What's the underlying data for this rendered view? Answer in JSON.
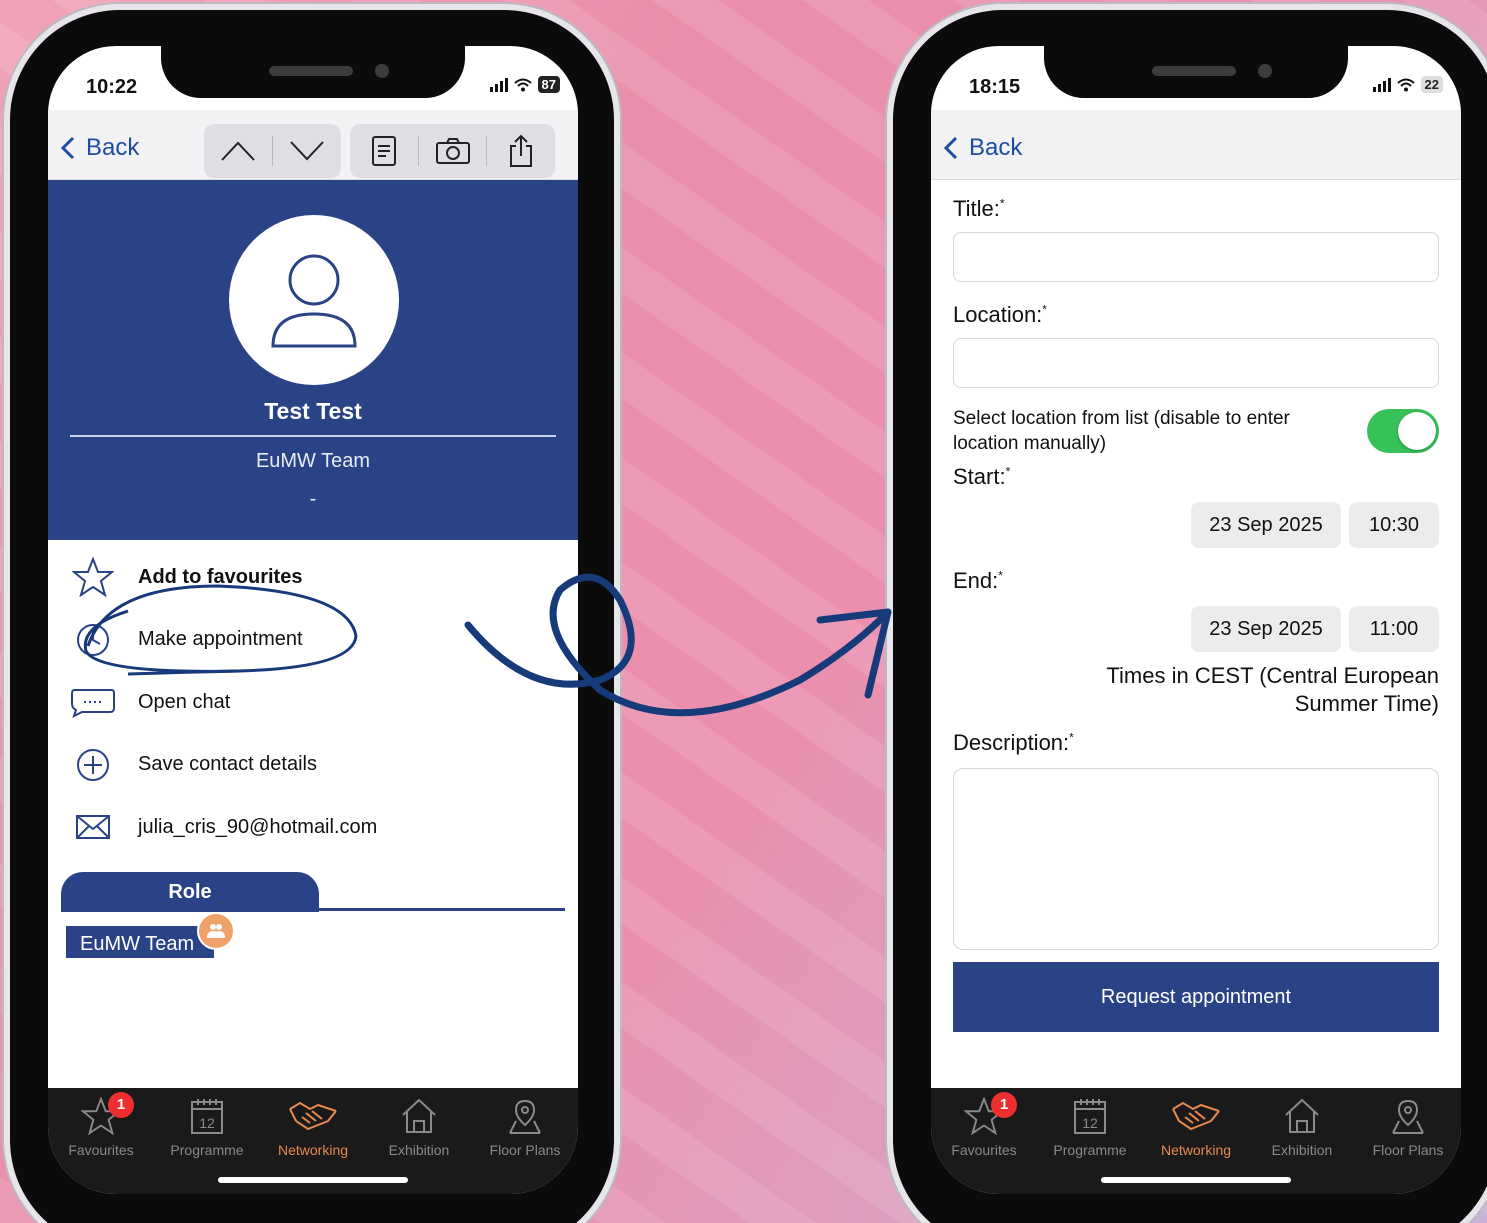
{
  "left_phone": {
    "status": {
      "time": "10:22",
      "battery": "87"
    },
    "nav": {
      "back_label": "Back"
    },
    "profile": {
      "name": "Test Test",
      "organization": "EuMW Team",
      "subtitle": "-"
    },
    "actions": [
      {
        "label": "Add to favourites",
        "icon": "star-icon"
      },
      {
        "label": "Make appointment",
        "icon": "clock-icon"
      },
      {
        "label": "Open chat",
        "icon": "chat-icon"
      },
      {
        "label": "Save contact details",
        "icon": "plus-circle-icon"
      },
      {
        "label": "julia_cris_90@hotmail.com",
        "icon": "mail-icon"
      }
    ],
    "role": {
      "tab_label": "Role",
      "value": "EuMW Team"
    }
  },
  "right_phone": {
    "status": {
      "time": "18:15",
      "battery": "22"
    },
    "nav": {
      "back_label": "Back"
    },
    "form": {
      "title_label": "Title:",
      "location_label": "Location:",
      "toggle_label": "Select location from list (disable to enter location manually)",
      "toggle_on": true,
      "start_label": "Start:",
      "start_date": "23 Sep 2025",
      "start_time": "10:30",
      "end_label": "End:",
      "end_date": "23 Sep 2025",
      "end_time": "11:00",
      "timezone_line1": "Times in CEST (Central European",
      "timezone_line2": "Summer Time)",
      "description_label": "Description:",
      "required_mark": "*",
      "submit_label": "Request appointment"
    }
  },
  "tabbar": {
    "items": [
      {
        "label": "Favourites",
        "icon": "star-icon",
        "badge": "1"
      },
      {
        "label": "Programme",
        "icon": "calendar-icon",
        "calendar_day": "12"
      },
      {
        "label": "Networking",
        "icon": "handshake-icon",
        "active": true
      },
      {
        "label": "Exhibition",
        "icon": "home-icon"
      },
      {
        "label": "Floor Plans",
        "icon": "map-pin-icon"
      }
    ]
  },
  "colors": {
    "brand_blue": "#2a4386",
    "accent_orange": "#e98a4d",
    "toggle_green": "#37c159",
    "link_blue": "#1d4da0",
    "annotation_navy": "#173a7a"
  }
}
